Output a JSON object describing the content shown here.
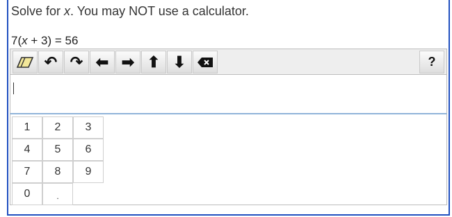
{
  "question": {
    "before_var": "Solve for ",
    "variable": "x",
    "after_var": ". You may NOT use a calculator."
  },
  "equation": {
    "part1": "7(",
    "var": "x",
    "part2": " + 3) = 56"
  },
  "toolbar": {
    "buttons": [
      {
        "name": "eraser-icon",
        "glyph": ""
      },
      {
        "name": "undo-icon",
        "glyph": "↶"
      },
      {
        "name": "redo-icon",
        "glyph": "↷"
      },
      {
        "name": "arrow-left-icon",
        "glyph": "⬅"
      },
      {
        "name": "arrow-right-icon",
        "glyph": "➡"
      },
      {
        "name": "arrow-up-icon",
        "glyph": "⬆"
      },
      {
        "name": "arrow-down-icon",
        "glyph": "⬇"
      },
      {
        "name": "backspace-icon",
        "glyph": ""
      }
    ],
    "help": "?"
  },
  "answer_input": {
    "value": ""
  },
  "keypad": {
    "keys": [
      "1",
      "2",
      "3",
      "4",
      "5",
      "6",
      "7",
      "8",
      "9",
      "0",
      "."
    ]
  }
}
